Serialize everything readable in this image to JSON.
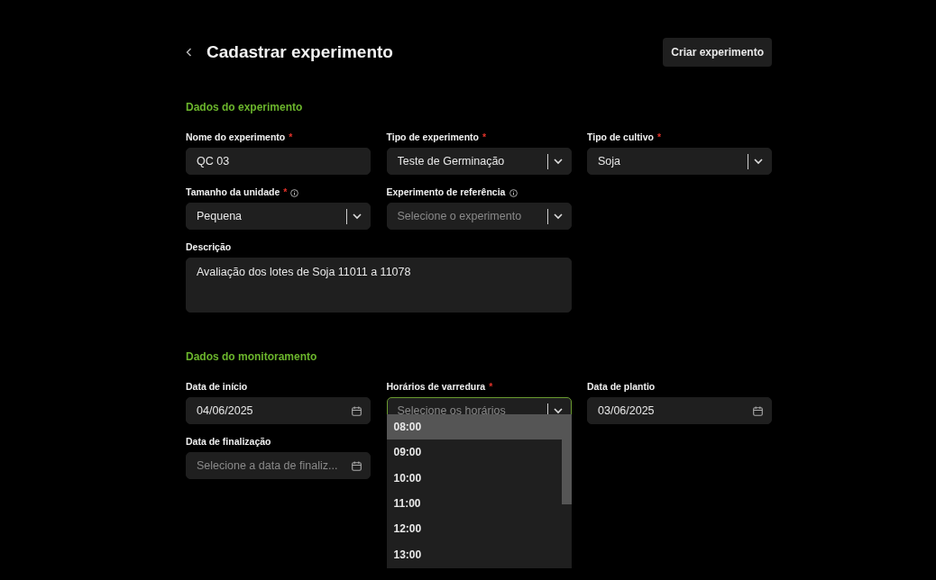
{
  "header": {
    "title": "Cadastrar experimento",
    "action": "Criar experimento"
  },
  "sections": [
    {
      "title": "Dados do experimento",
      "fields": [
        {
          "kind": "text",
          "label": "Nome do experimento",
          "required": "*",
          "info": false,
          "value": "QC 03"
        },
        {
          "kind": "select",
          "label": "Tipo de experimento",
          "required": "*",
          "info": false,
          "value": "Teste de Germinação"
        },
        {
          "kind": "select",
          "label": "Tipo de cultivo",
          "required": "*",
          "info": false,
          "value": "Soja"
        },
        {
          "kind": "select",
          "label": "Tamanho da unidade",
          "required": "*",
          "info": true,
          "value": "Pequena"
        },
        {
          "kind": "select",
          "label": "Experimento de referência",
          "info": true,
          "placeholder": "Selecione o experimento"
        },
        {
          "kind": "textarea",
          "label": "Descrição",
          "info": false,
          "value": "Avaliação dos lotes de Soja 11011 a 11078"
        }
      ]
    },
    {
      "title": "Dados do monitoramento",
      "fields": [
        {
          "kind": "date",
          "label": "Data de início",
          "info": false,
          "value": "04/06/2025"
        },
        {
          "kind": "select",
          "label": "Horários de varredura",
          "required": "*",
          "info": false,
          "placeholder": "Selecione os horários",
          "focused": true,
          "expanded": true,
          "options": [
            {
              "label": "08:00",
              "highlighted": true
            },
            {
              "label": "09:00",
              "highlighted": false
            },
            {
              "label": "10:00",
              "highlighted": false
            },
            {
              "label": "11:00",
              "highlighted": false
            },
            {
              "label": "12:00",
              "highlighted": false
            },
            {
              "label": "13:00",
              "highlighted": false
            }
          ]
        },
        {
          "kind": "date",
          "label": "Data de plantio",
          "info": false,
          "value": "03/06/2025"
        },
        {
          "kind": "date",
          "label": "Data de finalização",
          "info": false,
          "placeholder": "Selecione a data de finaliz..."
        }
      ]
    }
  ]
}
